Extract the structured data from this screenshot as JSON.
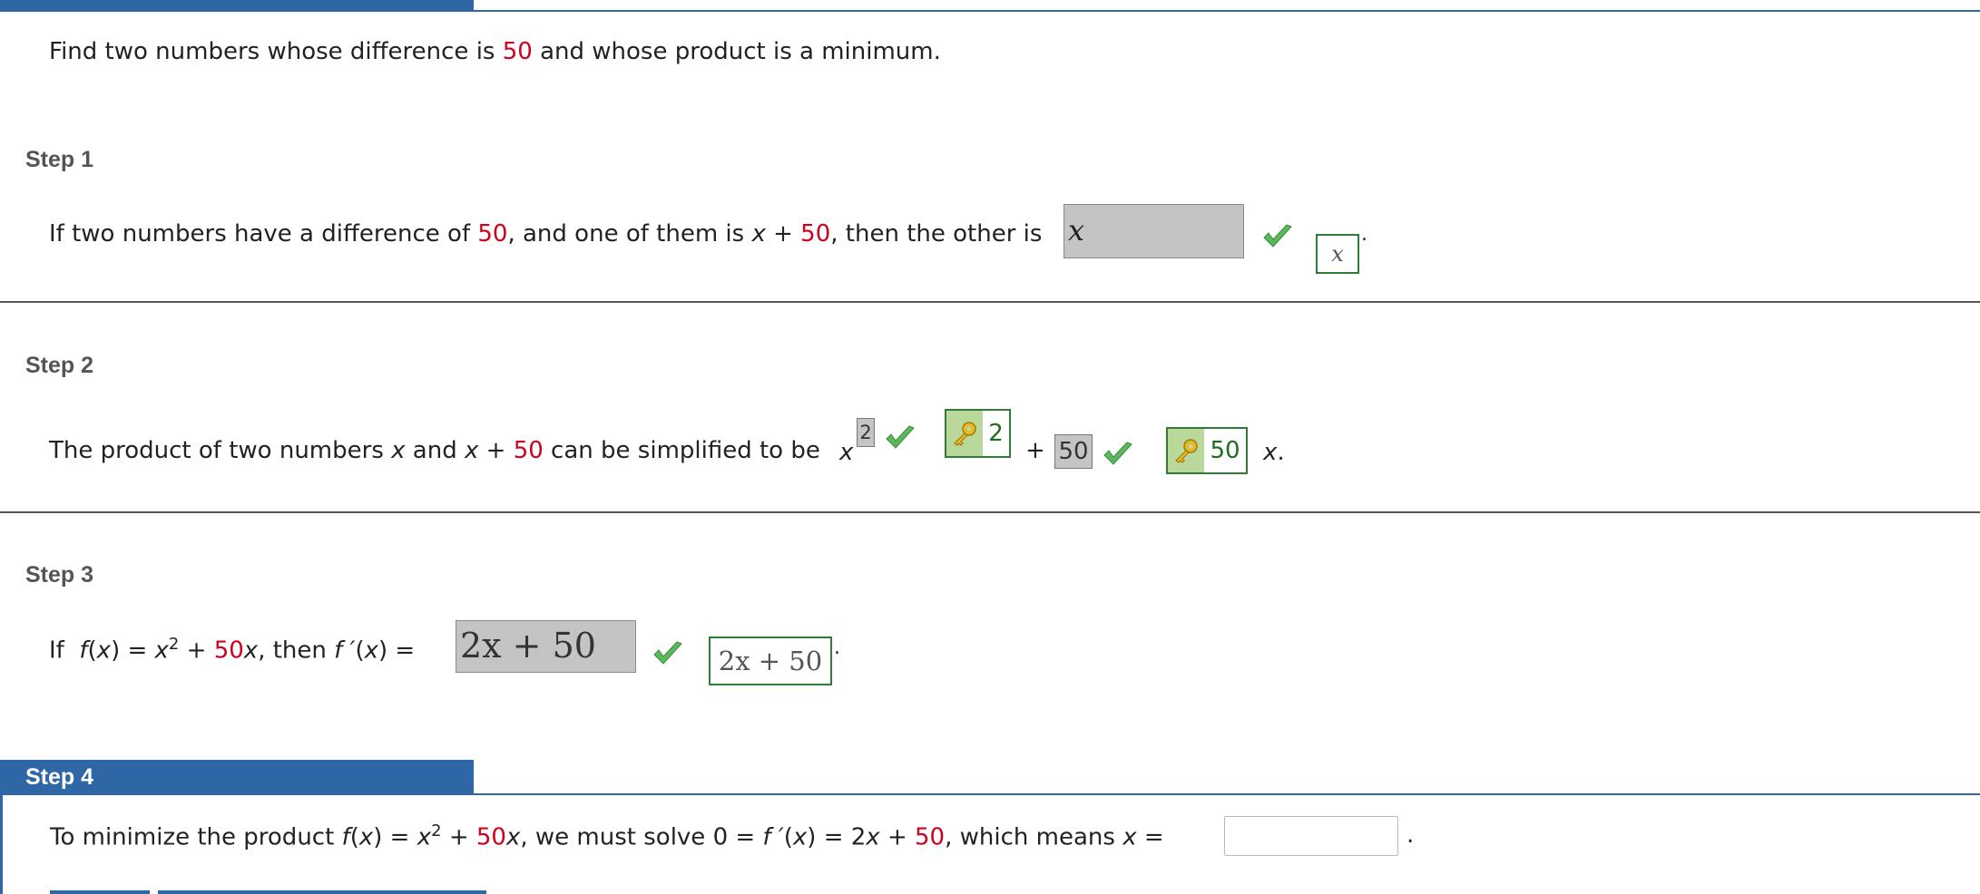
{
  "problem": {
    "pre": "Find two numbers whose difference is ",
    "num": "50",
    "post": " and whose product is a minimum."
  },
  "step1": {
    "label": "Step 1",
    "t1": "If two numbers have a difference of ",
    "n1": "50",
    "t2": ", and one of them is ",
    "var": "x",
    "t3": " + ",
    "n2": "50",
    "t4": ", then the other is",
    "answer": "x",
    "correct": "x",
    "period": "."
  },
  "step2": {
    "label": "Step 2",
    "t1": "The product of two numbers ",
    "var1": "x",
    "t2": " and ",
    "var2": "x",
    "t3": " + ",
    "n1": "50",
    "t4": " can be simplified to be ",
    "var3": "x",
    "exp_answer": "2",
    "exp_key": "2",
    "plus": "+",
    "coef_answer": "50",
    "coef_key": "50",
    "var4": "x",
    "period": "."
  },
  "step3": {
    "label": "Step 3",
    "t_if": "If",
    "f": "f",
    "fx_open": "(",
    "fx_var": "x",
    "fx_close": ") = ",
    "x2_base": "x",
    "x2_exp": "2",
    "plus": " + ",
    "n1": "50",
    "x_after": "x",
    "t_then": ",  then ",
    "fp": "f ′",
    "fp_paren": "(",
    "fp_var": "x",
    "fp_close": ") =",
    "answer": "2x + 50",
    "correct": "2x + 50",
    "period": "."
  },
  "step4": {
    "label": "Step 4",
    "t1": "To minimize the product ",
    "f": "f",
    "p1": "(",
    "v1": "x",
    "p2": ") = ",
    "xb": "x",
    "xe": "2",
    "pl": " + ",
    "n1": "50",
    "v2": "x",
    "t2": ",  we must solve  0 = ",
    "fp": "f ′",
    "p3": "(",
    "v3": "x",
    "p4": ") = 2",
    "v4": "x",
    "pl2": " + ",
    "n2": "50",
    "t3": ",  which means ",
    "v5": "x",
    "eq": " =",
    "period": "."
  },
  "colors": {
    "accent_blue": "#2f67a6",
    "highlight_red": "#d0021b",
    "correct_green": "#2e7d32"
  }
}
